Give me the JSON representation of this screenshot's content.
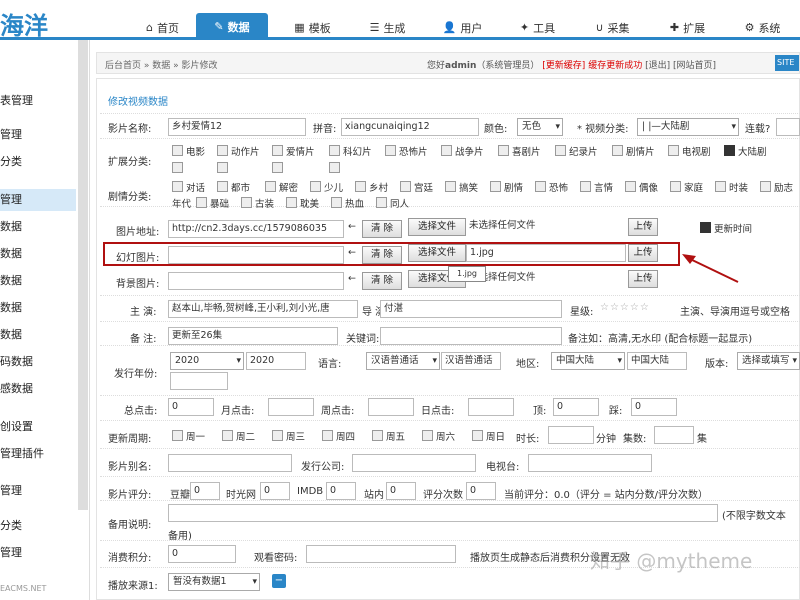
{
  "logo": "海洋",
  "nav": [
    "首页",
    "数据",
    "模板",
    "生成",
    "用户",
    "工具",
    "采集",
    "扩展",
    "系统"
  ],
  "sidebar": [
    "表管理",
    "管理",
    "分类",
    "管理",
    "数据",
    "数据",
    "数据",
    "数据",
    "数据",
    "码数据",
    "感数据",
    "创设置",
    "管理插件",
    "管理",
    "分类",
    "管理"
  ],
  "sidebar_footer": "EACMS.NET",
  "breadcrumb": "后台首页 » 数据 » 影片修改",
  "welcome": {
    "pre": "您好",
    "user": "admin",
    "role": "（系统管理员）",
    "update": "[更新缓存]",
    "cache": "缓存更新成功",
    "logout": "[退出]",
    "home": "[网站首页]",
    "site": "SITE"
  },
  "panel_title": "修改视频数据",
  "form": {
    "name_label": "影片名称:",
    "name_value": "乡村爱情12",
    "pinyin_label": "拼音:",
    "pinyin_value": "xiangcunaiqing12",
    "color_label": "颜色:",
    "color_value": "无色",
    "category_label": "* 视频分类:",
    "category_value": "|  |—大陆剧",
    "lock_label": "连载?",
    "ext_label": "扩展分类:",
    "ext_cats": [
      "电影",
      "动作片",
      "爱情片",
      "科幻片",
      "恐怖片",
      "战争片",
      "喜剧片",
      "纪录片",
      "剧情片",
      "电视剧",
      "大陆剧"
    ],
    "plot_label": "剧情分类:",
    "plots": [
      "对话",
      "都市",
      "解密",
      "少儿",
      "乡村",
      "宫廷",
      "搞笑",
      "剧情",
      "恐怖",
      "言情",
      "偶像",
      "家庭",
      "时装",
      "励志",
      "年代",
      "暴础",
      "古装",
      "耽美",
      "热血",
      "同人"
    ],
    "pic_label": "图片地址:",
    "pic_value": "http://cn2.3days.cc/1579086035",
    "clear": "清 除",
    "choose": "选择文件",
    "nofile": "未选择任何文件",
    "upload": "上传",
    "update_time": "更新时间",
    "slide_label": "幻灯图片:",
    "slide_file": "1.jpg",
    "tooltip": "1.jpg",
    "bg_label": "背景图片:",
    "bg_file": "未选择任何文件",
    "actor_label": "主 演:",
    "actor_value": "赵本山,毕畅,贺树峰,王小利,刘小光,唐",
    "director_label": "导 演:",
    "director_value": "付湛",
    "rating_label": "星级:",
    "rating_note": "主演、导演用逗号或空格",
    "remark_label": "备 注:",
    "remark_value": "更新至26集",
    "keyword_label": "关键词:",
    "remark_tip": "备注如：高清,无水印 (配合标题一起显示)",
    "year_label": "发行年份:",
    "year_select": "2020",
    "year_value": "2020",
    "lang_label": "语言:",
    "lang_select": "汉语普通话",
    "lang_value": "汉语普通话",
    "area_label": "地区:",
    "area_select": "中国大陆",
    "area_value": "中国大陆",
    "version_label": "版本:",
    "version_value": "选择或填写",
    "hits_total": "总点击:",
    "hits_total_v": "0",
    "hits_month": "月点击:",
    "hits_week": "周点击:",
    "hits_day": "日点击:",
    "up": "顶:",
    "up_v": "0",
    "down": "踩:",
    "down_v": "0",
    "period_label": "更新周期:",
    "weekdays": [
      "周一",
      "周二",
      "周三",
      "周四",
      "周五",
      "周六",
      "周日"
    ],
    "duration": "时长:",
    "minutes": "分钟",
    "episodes": "集数:",
    "ep_unit": "集",
    "alias_label": "影片别名:",
    "company_label": "发行公司:",
    "tv_label": "电视台:",
    "score_label": "影片评分:",
    "douban": "豆瓣",
    "douban_v": "0",
    "mtime": "时光网",
    "mtime_v": "0",
    "imdb": "IMDB",
    "imdb_v": "0",
    "site_score": "站内",
    "site_v": "0",
    "votes": "评分次数",
    "votes_v": "0",
    "current_score": "当前评分：0.0（评分 = 站内分数/评分次数）",
    "desc_label": "备用说明:",
    "desc_note": "(不限字数文本",
    "desc_tail": "备用)",
    "points_label": "消费积分:",
    "points_v": "0",
    "password_label": "观看密码:",
    "static_note": "播放页生成静态后消费积分设置无效",
    "source_label": "播放来源1:",
    "source_value": "暂没有数据1"
  },
  "watermark": "知乎 @mytheme"
}
